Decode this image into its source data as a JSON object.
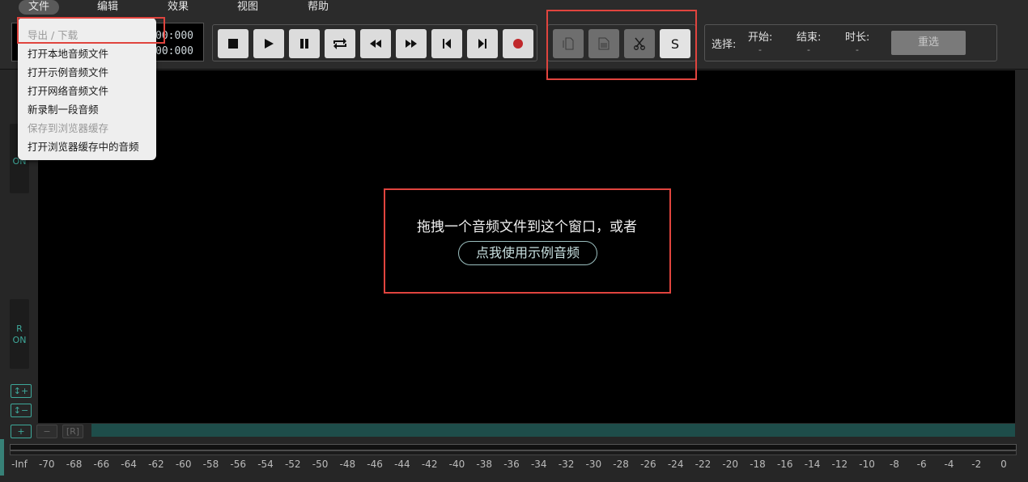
{
  "menubar": {
    "file": "文件",
    "edit": "编辑",
    "effects": "效果",
    "view": "视图",
    "help": "帮助"
  },
  "file_menu": {
    "items": [
      {
        "label": "导出 / 下载",
        "disabled": true
      },
      {
        "label": "打开本地音频文件",
        "disabled": false
      },
      {
        "label": "打开示例音频文件",
        "disabled": false
      },
      {
        "label": "打开网络音频文件",
        "disabled": false
      },
      {
        "label": "新录制一段音频",
        "disabled": false
      },
      {
        "label": "保存到浏览器缓存",
        "disabled": true
      },
      {
        "label": "打开浏览器缓存中的音频",
        "disabled": false
      }
    ]
  },
  "timecode": {
    "current": ":00:000",
    "total": ":00:000"
  },
  "transport": {
    "icons": [
      "stop-icon",
      "play-icon",
      "pause-icon",
      "loop-icon",
      "rewind-icon",
      "fast-forward-icon",
      "skip-start-icon",
      "skip-end-icon",
      "record-icon"
    ]
  },
  "edit_tools": {
    "copy_icon": "copy-icon",
    "paste_icon": "paste-icon",
    "cut_icon": "scissors-icon",
    "s_label": "S"
  },
  "selection": {
    "label": "选择:",
    "start_label": "开始:",
    "start_value": "-",
    "end_label": "结束:",
    "end_value": "-",
    "duration_label": "时长:",
    "duration_value": "-",
    "reselect_label": "重选"
  },
  "channels": {
    "left_label": "ON",
    "right_letter": "R",
    "right_label": "ON"
  },
  "waveform": {
    "drop_text": "拖拽一个音频文件到这个窗口，或者",
    "sample_button": "点我使用示例音频"
  },
  "zoom": {
    "v_zoom_in": "↕+",
    "v_zoom_out": "↕−",
    "h_zoom_in": "+",
    "h_zoom_out": "−",
    "reset": "[R]"
  },
  "meter_scale": [
    "-Inf",
    "-70",
    "-68",
    "-66",
    "-64",
    "-62",
    "-60",
    "-58",
    "-56",
    "-54",
    "-52",
    "-50",
    "-48",
    "-46",
    "-44",
    "-42",
    "-40",
    "-38",
    "-36",
    "-34",
    "-32",
    "-30",
    "-28",
    "-26",
    "-24",
    "-22",
    "-20",
    "-18",
    "-16",
    "-14",
    "-12",
    "-10",
    "-8",
    "-6",
    "-4",
    "-2",
    "0"
  ],
  "colors": {
    "accent_teal": "#3ea89a",
    "highlight_red": "#e0443e",
    "record_red": "#c0282b"
  }
}
